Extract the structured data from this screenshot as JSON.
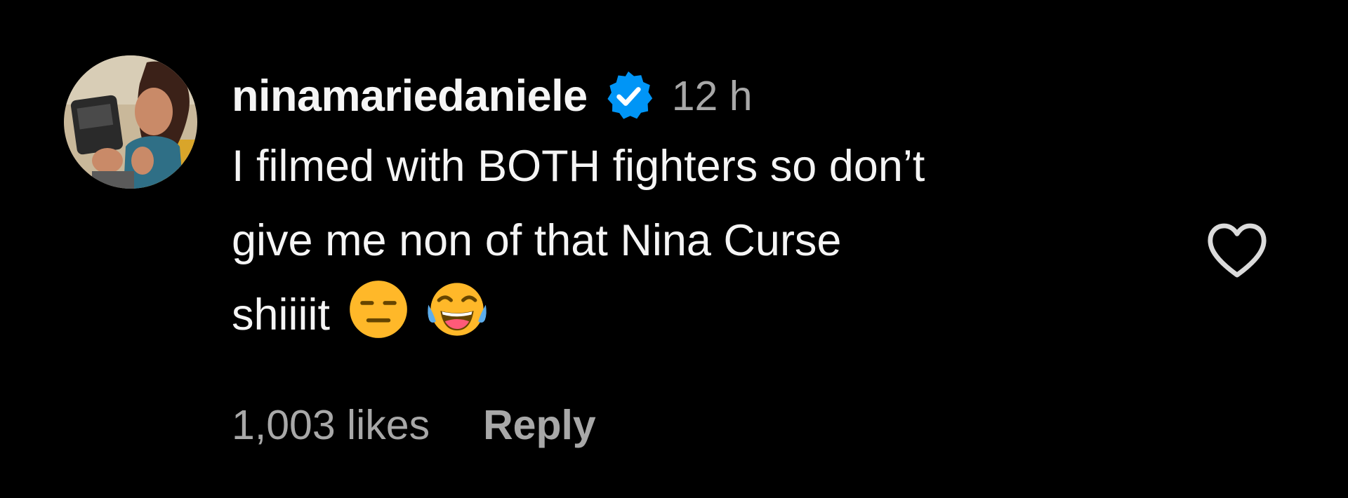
{
  "comment": {
    "username": "ninamariedaniele",
    "verified": true,
    "timestamp": "12 h",
    "text_lines": [
      "I filmed with BOTH fighters so don’t",
      "give me non of that Nina Curse",
      "shiiiit"
    ],
    "emojis": [
      "expressionless-face-emoji",
      "tears-of-joy-emoji"
    ],
    "likes_label": "1,003 likes",
    "reply_label": "Reply",
    "like_icon": "heart-outline-icon",
    "avatar_icon": "profile-photo-avatar"
  },
  "colors": {
    "background": "#000000",
    "primary_text": "#f5f5f5",
    "secondary_text": "#a8a8a8",
    "verified_badge": "#0095f6",
    "emoji_yellow": "#ffb829"
  }
}
